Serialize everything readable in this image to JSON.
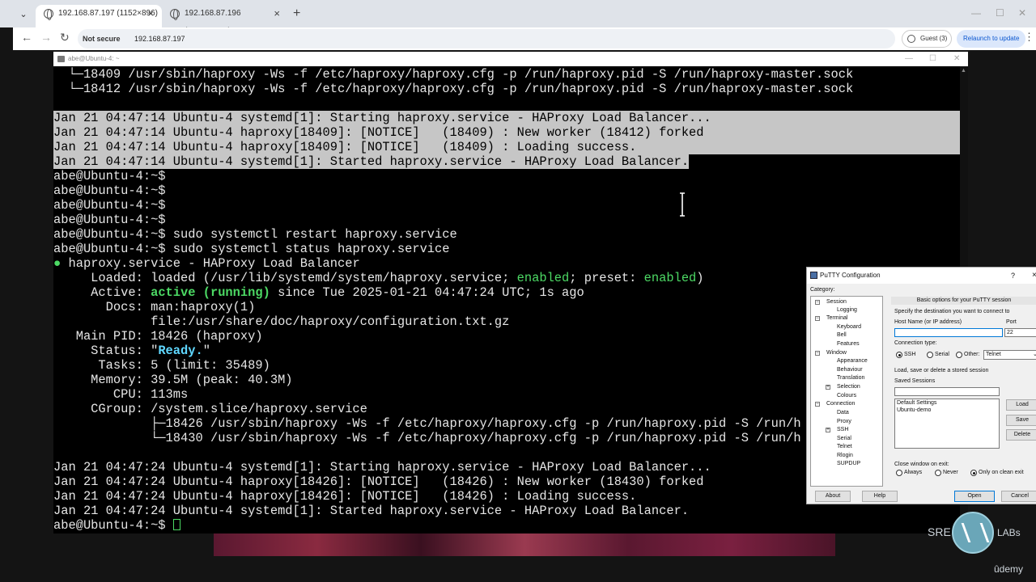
{
  "browser": {
    "tabs": [
      {
        "title": "192.168.87.197 (1152×896)",
        "active": true
      },
      {
        "title": "192.168.87.196 (1024×1024)",
        "active": false
      }
    ],
    "security_label": "Not secure",
    "url": "192.168.87.197",
    "profile_label": "Guest (3)",
    "relaunch_label": "Relaunch to update"
  },
  "terminal": {
    "title": "abe@Ubuntu-4: ~",
    "lines_top": [
      "  └─18409 /usr/sbin/haproxy -Ws -f /etc/haproxy/haproxy.cfg -p /run/haproxy.pid -S /run/haproxy-master.sock",
      "  └─18412 /usr/sbin/haproxy -Ws -f /etc/haproxy/haproxy.cfg -p /run/haproxy.pid -S /run/haproxy-master.sock"
    ],
    "log1": [
      "Jan 21 04:47:14 Ubuntu-4 systemd[1]: Starting haproxy.service - HAProxy Load Balancer...",
      "Jan 21 04:47:14 Ubuntu-4 haproxy[18409]: [NOTICE]   (18409) : New worker (18412) forked",
      "Jan 21 04:47:14 Ubuntu-4 haproxy[18409]: [NOTICE]   (18409) : Loading success.",
      "Jan 21 04:47:14 Ubuntu-4 systemd[1]: Started haproxy.service - HAProxy Load Balancer."
    ],
    "prompt": "abe@Ubuntu-4:~$",
    "cmd_restart": " sudo systemctl restart haproxy.service",
    "cmd_status": " sudo systemctl status haproxy.service",
    "status": {
      "bullet": "●",
      "unit": " haproxy.service - HAProxy Load Balancer",
      "loaded_prefix": "     Loaded: loaded (/usr/lib/systemd/system/haproxy.service; ",
      "enabled": "enabled",
      "loaded_mid": "; preset: ",
      "preset": "enabled",
      "loaded_suffix": ")",
      "active_prefix": "     Active: ",
      "active_state": "active (running)",
      "active_suffix": " since Tue 2025-01-21 04:47:24 UTC; 1s ago",
      "docs1": "       Docs: man:haproxy(1)",
      "docs2": "             file:/usr/share/doc/haproxy/configuration.txt.gz",
      "main_pid": "   Main PID: 18426 (haproxy)",
      "status_prefix": "     Status: \"",
      "status_value": "Ready.",
      "status_suffix": "\"",
      "tasks": "      Tasks: 5 (limit: 35489)",
      "memory": "     Memory: 39.5M (peak: 40.3M)",
      "cpu": "        CPU: 113ms",
      "cgroup": "     CGroup: /system.slice/haproxy.service",
      "proc1": "             ├─18426 /usr/sbin/haproxy -Ws -f /etc/haproxy/haproxy.cfg -p /run/haproxy.pid -S /run/h",
      "proc2": "             └─18430 /usr/sbin/haproxy -Ws -f /etc/haproxy/haproxy.cfg -p /run/haproxy.pid -S /run/h"
    },
    "log2": [
      "Jan 21 04:47:24 Ubuntu-4 systemd[1]: Starting haproxy.service - HAProxy Load Balancer...",
      "Jan 21 04:47:24 Ubuntu-4 haproxy[18426]: [NOTICE]   (18426) : New worker (18430) forked",
      "Jan 21 04:47:24 Ubuntu-4 haproxy[18426]: [NOTICE]   (18426) : Loading success.",
      "Jan 21 04:47:24 Ubuntu-4 systemd[1]: Started haproxy.service - HAProxy Load Balancer."
    ]
  },
  "putty": {
    "title": "PuTTY Configuration",
    "help_mark": "?",
    "close_mark": "×",
    "category_label": "Category:",
    "tree": [
      "Session",
      "Logging",
      "Terminal",
      "Keyboard",
      "Bell",
      "Features",
      "Window",
      "Appearance",
      "Behaviour",
      "Translation",
      "Selection",
      "Colours",
      "Connection",
      "Data",
      "Proxy",
      "SSH",
      "Serial",
      "Telnet",
      "Rlogin",
      "SUPDUP"
    ],
    "header": "Basic options for your PuTTY session",
    "dest_label": "Specify the destination you want to connect to",
    "host_label": "Host Name (or IP address)",
    "host_value": "",
    "port_label": "Port",
    "port_value": "22",
    "conn_type_label": "Connection type:",
    "conn_types": [
      "SSH",
      "Serial",
      "Other:"
    ],
    "other_value": "Telnet",
    "sessions_group": "Load, save or delete a stored session",
    "saved_sessions_label": "Saved Sessions",
    "saved_sessions_value": "",
    "sessions": [
      "Default Settings",
      "Ubuntu-demo"
    ],
    "load": "Load",
    "save": "Save",
    "delete": "Delete",
    "close_exit_label": "Close window on exit:",
    "exit_options": [
      "Always",
      "Never",
      "Only on clean exit"
    ],
    "about": "About",
    "help": "Help",
    "open": "Open",
    "cancel": "Cancel"
  },
  "branding": {
    "sre": "SRE",
    "labs": "LABs",
    "udemy": "ûdemy"
  }
}
